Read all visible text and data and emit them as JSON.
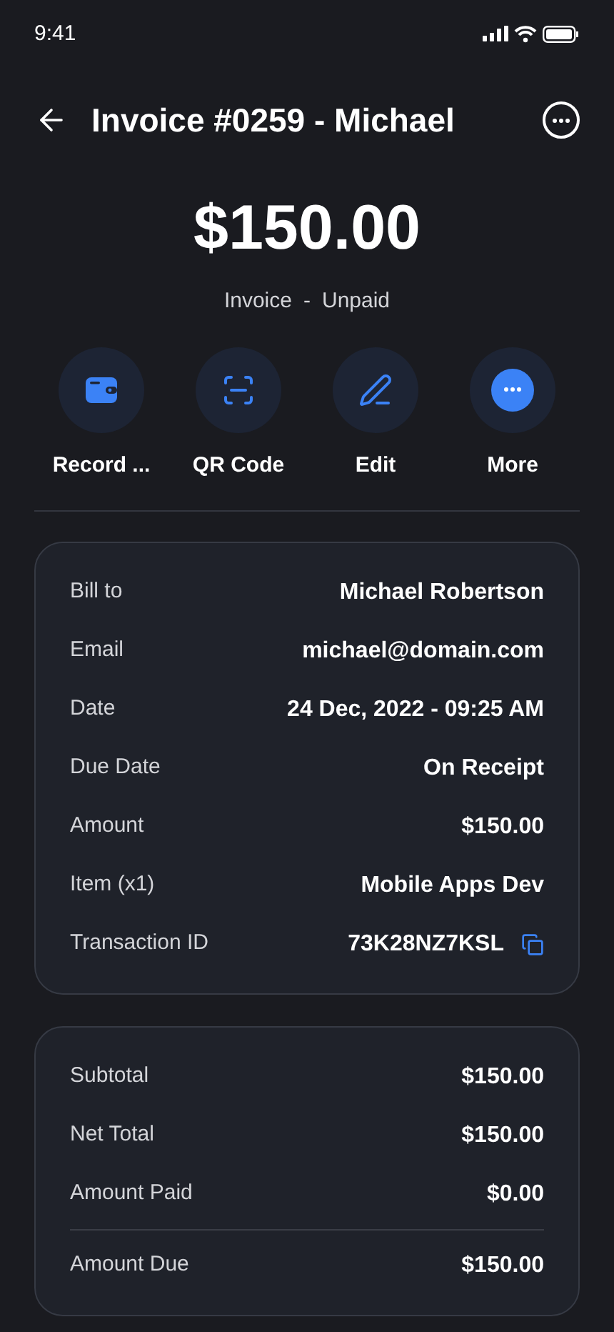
{
  "status_bar": {
    "time": "9:41"
  },
  "header": {
    "title": "Invoice #0259 - Michael"
  },
  "amount": "$150.00",
  "subtitle": {
    "type": "Invoice",
    "separator": "-",
    "status": "Unpaid"
  },
  "actions": [
    {
      "label": "Record ...",
      "kind": "wallet"
    },
    {
      "label": "QR Code",
      "kind": "scan"
    },
    {
      "label": "Edit",
      "kind": "edit"
    },
    {
      "label": "More",
      "kind": "more"
    }
  ],
  "details": [
    {
      "label": "Bill to",
      "value": "Michael Robertson",
      "kind": "plain"
    },
    {
      "label": "Email",
      "value": "michael@domain.com",
      "kind": "plain"
    },
    {
      "label": "Date",
      "value": "24 Dec, 2022 - 09:25 AM",
      "kind": "plain"
    },
    {
      "label": "Due Date",
      "value": "On Receipt",
      "kind": "plain"
    },
    {
      "label": "Amount",
      "value": "$150.00",
      "kind": "plain"
    },
    {
      "label": "Item (x1)",
      "value": "Mobile Apps Dev",
      "kind": "plain"
    },
    {
      "label": "Transaction ID",
      "value": "73K28NZ7KSL",
      "kind": "copy"
    }
  ],
  "summary": [
    {
      "label": "Subtotal",
      "value": "$150.00",
      "kind": "plain"
    },
    {
      "label": "Net Total",
      "value": "$150.00",
      "kind": "plain"
    },
    {
      "label": "Amount Paid",
      "value": "$0.00",
      "kind": "plain"
    },
    {
      "label": "Amount Due",
      "value": "$150.00",
      "kind": "total"
    }
  ]
}
